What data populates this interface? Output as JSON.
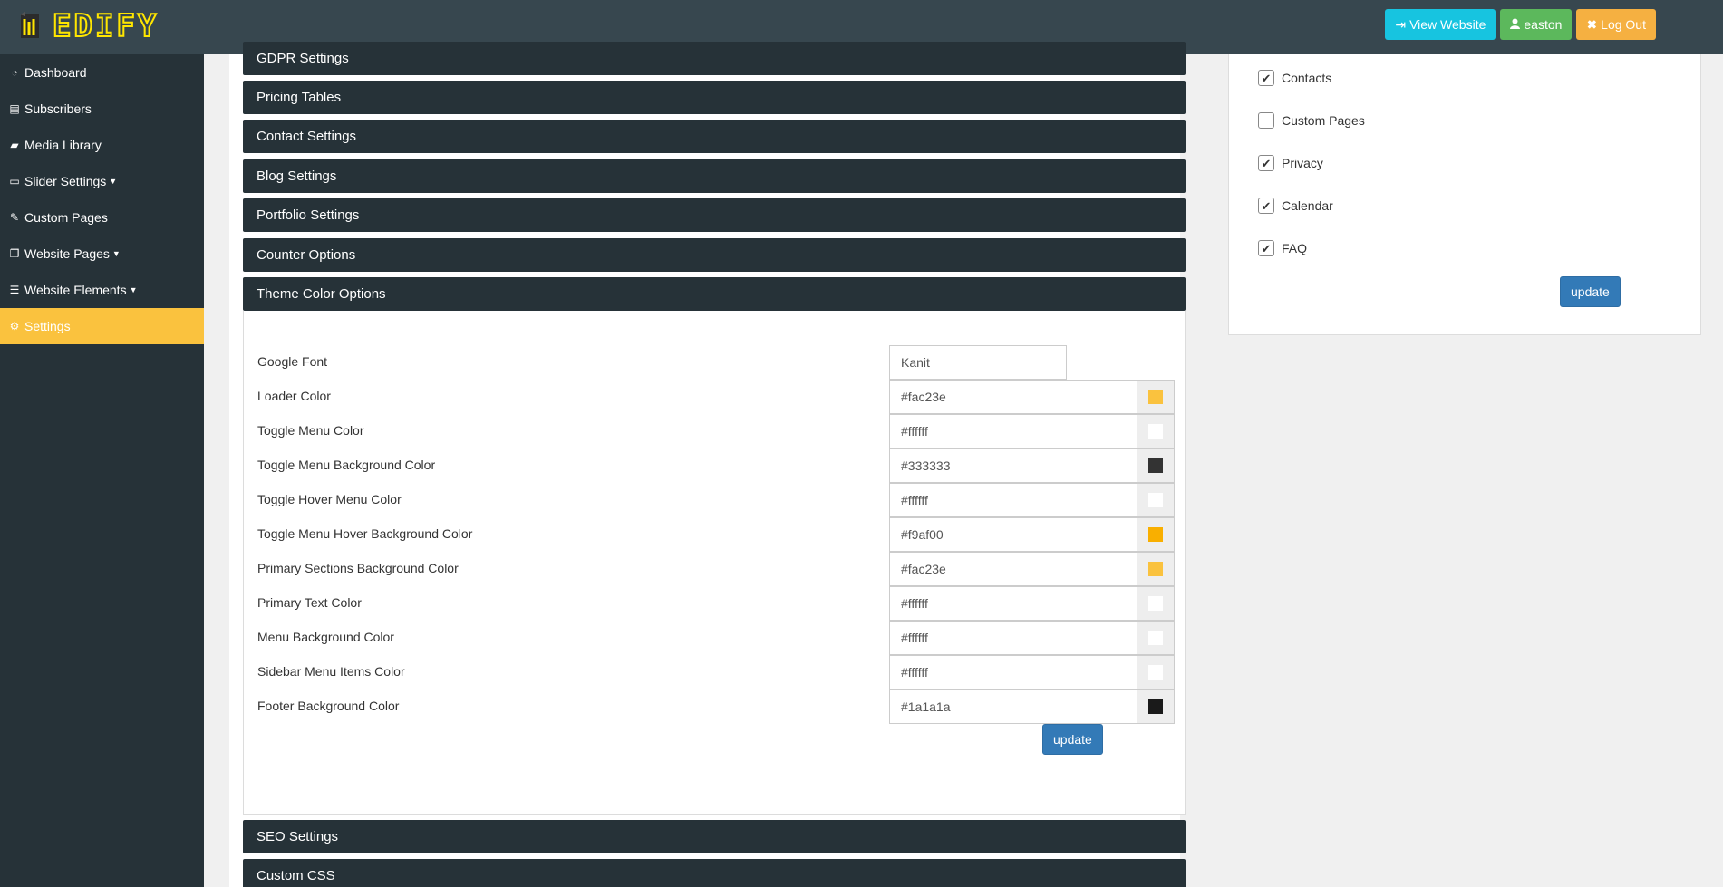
{
  "brand": {
    "name": "EDIFY",
    "accent": "#ffe600"
  },
  "topbar": {
    "view_website": {
      "icon": "sign-in-icon",
      "label": "View Website"
    },
    "user": {
      "icon": "user-icon",
      "label": "easton"
    },
    "logout": {
      "icon": "close-icon",
      "label": "Log Out"
    }
  },
  "sidebar": {
    "items": [
      {
        "icon": "dashboard-icon",
        "label": "Dashboard"
      },
      {
        "icon": "newspaper-icon",
        "label": "Subscribers"
      },
      {
        "icon": "folder-icon",
        "label": "Media Library"
      },
      {
        "icon": "desktop-icon",
        "label": "Slider Settings"
      },
      {
        "icon": "edit-icon",
        "label": "Custom Pages"
      },
      {
        "icon": "pages-icon",
        "label": "Website Pages"
      },
      {
        "icon": "list-icon",
        "label": "Website Elements"
      },
      {
        "icon": "cogs-icon",
        "label": "Settings"
      }
    ],
    "active": "Settings"
  },
  "panels": {
    "gdpr": "GDPR Settings",
    "pricing": "Pricing Tables",
    "contact": "Contact Settings",
    "blog": "Blog Settings",
    "portfolio": "Portfolio Settings",
    "counter": "Counter Options",
    "theme": "Theme Color Options",
    "seo": "SEO Settings",
    "css": "Custom CSS"
  },
  "theme_form": {
    "google_font": {
      "label": "Google Font",
      "value": "Kanit"
    },
    "colors": [
      {
        "label": "Loader Color",
        "value": "#fac23e"
      },
      {
        "label": "Toggle Menu Color",
        "value": "#ffffff"
      },
      {
        "label": "Toggle Menu Background Color",
        "value": "#333333"
      },
      {
        "label": "Toggle Hover Menu Color",
        "value": "#ffffff"
      },
      {
        "label": "Toggle Menu Hover Background Color",
        "value": "#f9af00"
      },
      {
        "label": "Primary Sections Background Color",
        "value": "#fac23e"
      },
      {
        "label": "Primary Text Color",
        "value": "#ffffff"
      },
      {
        "label": "Menu Background Color",
        "value": "#ffffff"
      },
      {
        "label": "Sidebar Menu Items Color",
        "value": "#ffffff"
      },
      {
        "label": "Footer Background Color",
        "value": "#1a1a1a"
      }
    ],
    "update_label": "update"
  },
  "modules": {
    "items": [
      {
        "label": "Contacts",
        "checked": true
      },
      {
        "label": "Custom Pages",
        "checked": false
      },
      {
        "label": "Privacy",
        "checked": true
      },
      {
        "label": "Calendar",
        "checked": true
      },
      {
        "label": "FAQ",
        "checked": true
      }
    ],
    "update_label": "update"
  }
}
